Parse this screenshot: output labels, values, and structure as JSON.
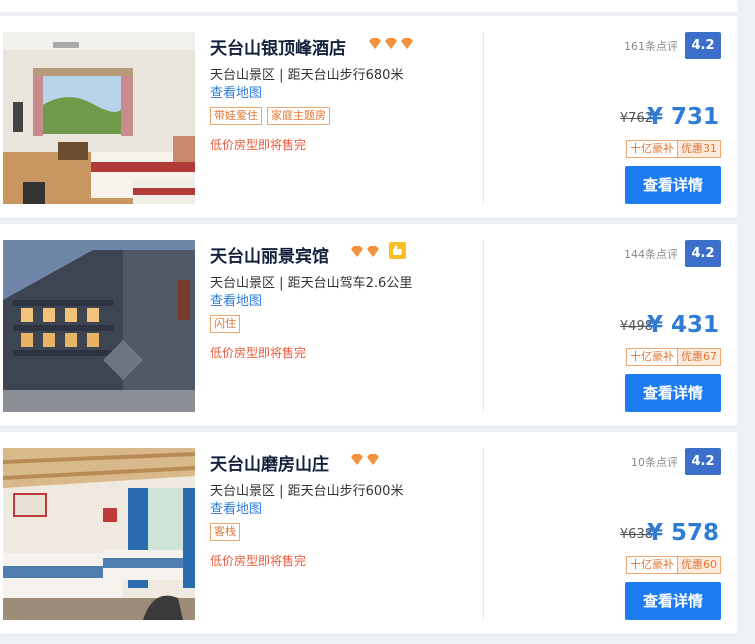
{
  "hotels": [
    {
      "name": "天台山银顶峰酒店",
      "location": "天台山景区 | 距天台山步行680米",
      "map_link": "查看地图",
      "tags": [
        "带娃爱住",
        "家庭主题房"
      ],
      "selling_out": "低价房型即将售完",
      "reviews": "161条点评",
      "score": "4.2",
      "original_price": "¥762",
      "price": "¥ 731",
      "promo_label": "十亿豪补",
      "promo_discount": "优惠31",
      "button": "查看详情",
      "diamond_count": 3,
      "badge_icon": ""
    },
    {
      "name": "天台山丽景宾馆",
      "location": "天台山景区 | 距天台山驾车2.6公里",
      "map_link": "查看地图",
      "tags": [
        "闪住"
      ],
      "selling_out": "低价房型即将售完",
      "reviews": "144条点评",
      "score": "4.2",
      "original_price": "¥498",
      "price": "¥ 431",
      "promo_label": "十亿豪补",
      "promo_discount": "优惠67",
      "button": "查看详情",
      "diamond_count": 2,
      "badge_icon": "thumbs-up-icon"
    },
    {
      "name": "天台山磨房山庄",
      "location": "天台山景区 | 距天台山步行600米",
      "map_link": "查看地图",
      "tags": [
        "客栈"
      ],
      "selling_out": "低价房型即将售完",
      "reviews": "10条点评",
      "score": "4.2",
      "original_price": "¥638",
      "price": "¥ 578",
      "promo_label": "十亿豪补",
      "promo_discount": "优惠60",
      "button": "查看详情",
      "diamond_count": 2,
      "badge_icon": ""
    }
  ],
  "colors": {
    "accent_blue": "#2f7bd6",
    "button_blue": "#1e7cf2",
    "score_blue": "#3b6fcb",
    "diamond_orange": "#f5913a",
    "tag_orange": "#e67332",
    "selling_red": "#ea5a3c"
  }
}
